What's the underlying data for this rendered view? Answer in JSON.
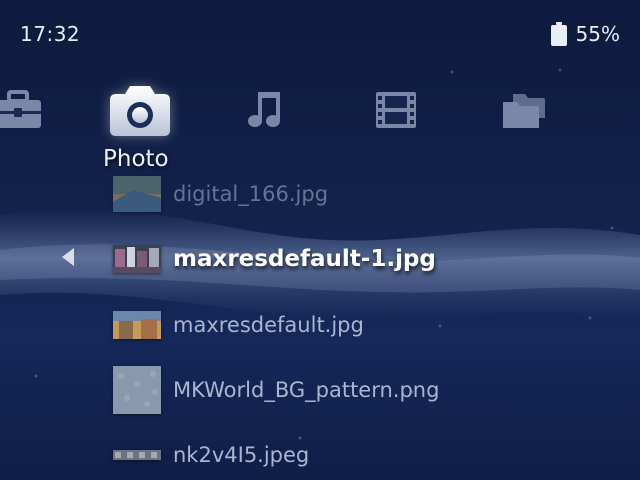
{
  "status_bar": {
    "time": "17:32",
    "battery_percent": "55%",
    "battery_icon": "battery-icon"
  },
  "categories": [
    {
      "icon": "toolbox-icon",
      "selected": false
    },
    {
      "icon": "camera-icon",
      "label": "Photo",
      "selected": true
    },
    {
      "icon": "music-note-icon",
      "selected": false
    },
    {
      "icon": "film-icon",
      "selected": false
    },
    {
      "icon": "folders-icon",
      "selected": false
    }
  ],
  "selected_category_label": "Photo",
  "files": [
    {
      "name": "digital_166.jpg",
      "state": "faded"
    },
    {
      "name": "maxresdefault-1.jpg",
      "state": "selected"
    },
    {
      "name": "maxresdefault.jpg",
      "state": "normal"
    },
    {
      "name": "MKWorld_BG_pattern.png",
      "state": "normal"
    },
    {
      "name": "nk2v4I5.jpeg",
      "state": "normal"
    }
  ],
  "colors": {
    "background": "#12224b",
    "text_primary": "#ffffff",
    "text_secondary": "#aab6cf"
  }
}
